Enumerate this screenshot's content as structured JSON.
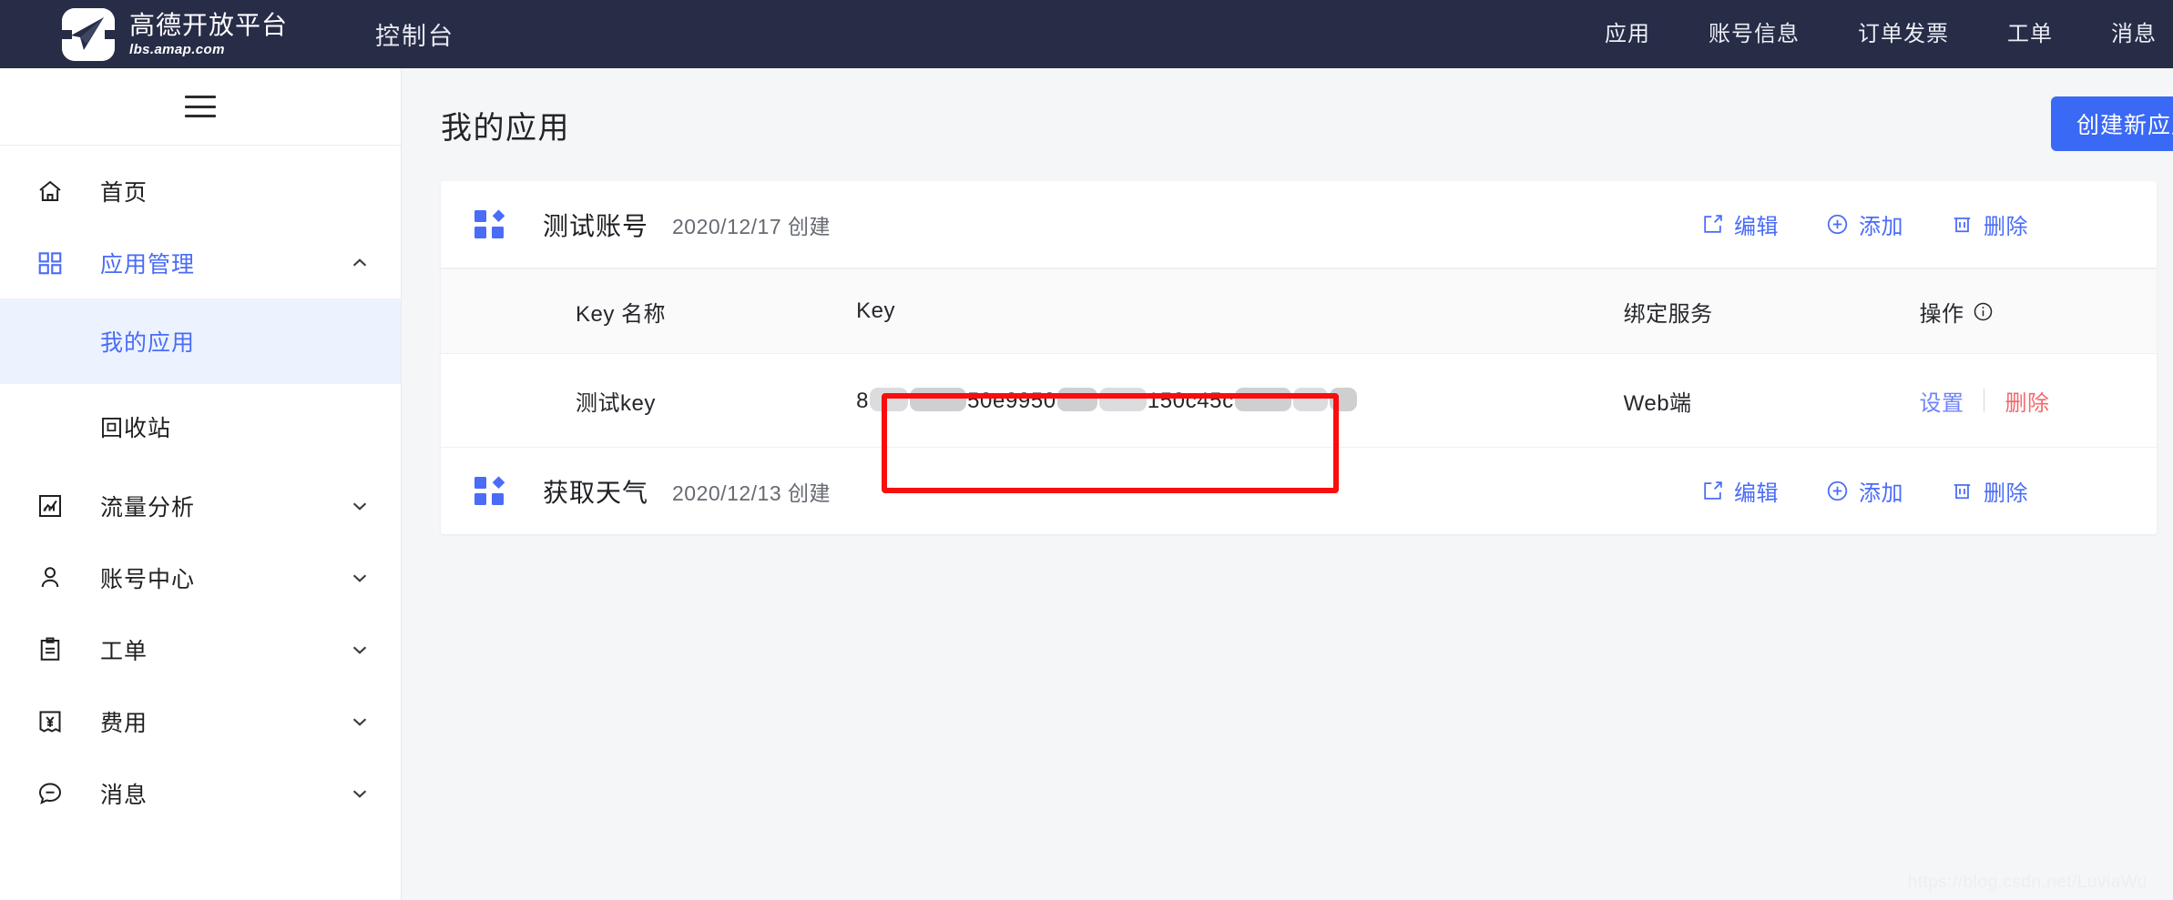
{
  "brand": {
    "title": "高德开放平台",
    "subtitle": "lbs.amap.com",
    "logo_icon": "amap-paper-plane-logo"
  },
  "topbar": {
    "console_label": "控制台",
    "nav_items": [
      {
        "label": "应用"
      },
      {
        "label": "账号信息"
      },
      {
        "label": "订单发票"
      },
      {
        "label": "工单"
      },
      {
        "label": "消息"
      }
    ]
  },
  "sidebar": {
    "toggle_icon": "hamburger-menu-icon",
    "items": [
      {
        "label": "首页",
        "icon": "home-icon",
        "arrow": "",
        "active": false
      },
      {
        "label": "应用管理",
        "icon": "apps-grid-icon",
        "arrow": "up",
        "active": true
      },
      {
        "label": "流量分析",
        "icon": "chart-icon",
        "arrow": "down",
        "active": false
      },
      {
        "label": "账号中心",
        "icon": "user-icon",
        "arrow": "down",
        "active": false
      },
      {
        "label": "工单",
        "icon": "clipboard-icon",
        "arrow": "down",
        "active": false
      },
      {
        "label": "费用",
        "icon": "yen-bill-icon",
        "arrow": "down",
        "active": false
      },
      {
        "label": "消息",
        "icon": "message-icon",
        "arrow": "down",
        "active": false
      }
    ],
    "sub_items": [
      {
        "label": "我的应用",
        "selected": true
      },
      {
        "label": "回收站",
        "selected": false
      }
    ]
  },
  "page": {
    "title": "我的应用",
    "create_button": "创建新应用"
  },
  "apps": [
    {
      "icon": "app-grid-icon",
      "name": "测试账号",
      "created": "2020/12/17 创建",
      "actions": [
        {
          "label": "编辑",
          "icon": "edit-square-icon"
        },
        {
          "label": "添加",
          "icon": "plus-circle-icon"
        },
        {
          "label": "删除",
          "icon": "trash-icon"
        }
      ]
    },
    {
      "icon": "app-grid-icon",
      "name": "获取天气",
      "created": "2020/12/13 创建",
      "actions": [
        {
          "label": "编辑",
          "icon": "edit-square-icon"
        },
        {
          "label": "添加",
          "icon": "plus-circle-icon"
        },
        {
          "label": "删除",
          "icon": "trash-icon"
        }
      ]
    }
  ],
  "key_table": {
    "columns": [
      {
        "label": "Key 名称"
      },
      {
        "label": "Key"
      },
      {
        "label": "绑定服务"
      },
      {
        "label": "操作",
        "info_icon": "info-circle-icon"
      }
    ],
    "rows": [
      {
        "key_name": "测试key",
        "key_value_visible_1": "50e9950",
        "key_value_visible_2": "150c45c",
        "key_value_prefix": "8",
        "bind_service": "Web端",
        "op_settings": "设置",
        "op_delete": "删除"
      }
    ]
  },
  "annotation": {
    "type": "red-rectangle-highlight",
    "color": "#fb0d0d",
    "target": "key-value-cell"
  },
  "watermark": "https://blog.csdn.net/LuviaWu",
  "colors": {
    "topbar_bg": "#272c47",
    "accent_blue": "#4a6cf7",
    "primary_button": "#3a69f5",
    "selected_item_bg": "#ecf3fe",
    "page_bg": "#f5f6f8",
    "delete_red": "#f2696b",
    "annotation_red": "#fb0d0d"
  }
}
